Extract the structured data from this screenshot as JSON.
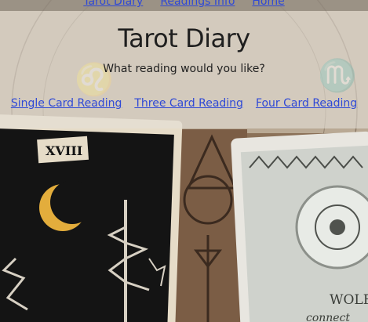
{
  "nav": {
    "items": [
      {
        "label": "Tarot Diary"
      },
      {
        "label": "Readings Info"
      },
      {
        "label": "Home"
      }
    ]
  },
  "header": {
    "title": "Tarot Diary",
    "subtitle": "What reading would you like?"
  },
  "readings": {
    "links": [
      {
        "label": "Single Card Reading"
      },
      {
        "label": "Three Card Reading"
      },
      {
        "label": "Four Card Reading"
      }
    ]
  },
  "background": {
    "card_left_numeral": "XVIII",
    "card_right_text_1": "WOLF",
    "card_right_text_2": "connect"
  },
  "colors": {
    "link": "#2f49d6",
    "text": "#1f1f1f",
    "band": "#e4ded6"
  }
}
